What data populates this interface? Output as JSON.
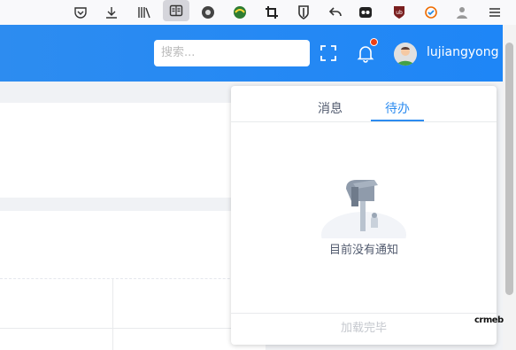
{
  "header": {
    "search_placeholder": "搜索...",
    "username": "lujiangyong",
    "notification_badge": "dot"
  },
  "notification_panel": {
    "tabs": [
      {
        "label": "消息",
        "active": false
      },
      {
        "label": "待办",
        "active": true
      }
    ],
    "empty_text": "目前没有通知",
    "footer_text": "加载完毕"
  },
  "watermark": "crmeb",
  "colors": {
    "header_bg": "#2d8cf0",
    "accent": "#2d8cf0",
    "badge": "#ed4014"
  },
  "browser_toolbar_icons": [
    "pocket-icon",
    "download-icon",
    "library-icon",
    "reader-view-icon",
    "extension-icon",
    "extension-icon",
    "crop-icon",
    "bitwarden-icon",
    "back-reply-icon",
    "extension-icon",
    "ublock-icon",
    "extension-icon",
    "extension-icon",
    "menu-icon"
  ]
}
